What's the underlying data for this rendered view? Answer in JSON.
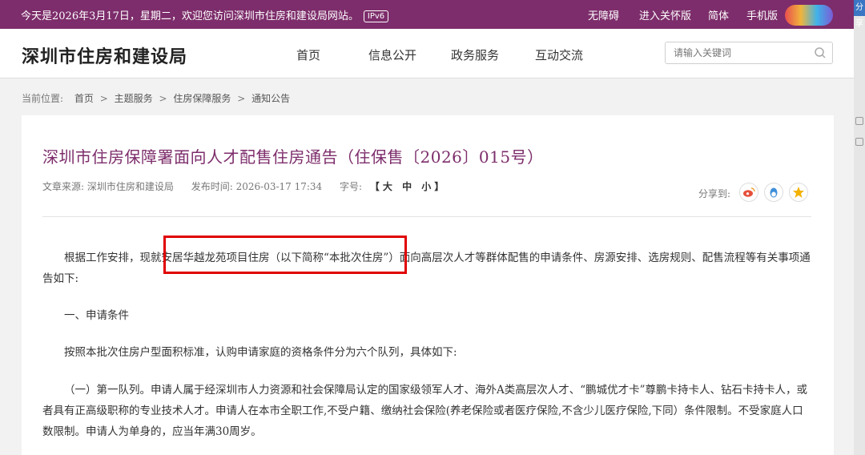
{
  "topbar": {
    "welcome": "今天是2026年3月17日，星期二，欢迎您访问深圳市住房和建设局网站。",
    "ipv6_badge": "IPv6",
    "links": [
      "无障碍",
      "进入关怀版",
      "简体",
      "手机版"
    ],
    "edge_tag": "分享"
  },
  "header": {
    "site_title": "深圳市住房和建设局",
    "nav": [
      "首页",
      "信息公开",
      "政务服务",
      "互动交流"
    ],
    "search_placeholder": "请输入关键词"
  },
  "breadcrumb": {
    "label": "当前位置:",
    "items": [
      "首页",
      "主题服务",
      "住房保障服务",
      "通知公告"
    ]
  },
  "article": {
    "title": "深圳市住房保障署面向人才配售住房通告（住保售〔2026〕015号）",
    "source_label": "文章来源:",
    "source": "深圳市住房和建设局",
    "time_label": "发布时间:",
    "time": "2026-03-17 17:34",
    "font_label": "字号:",
    "font_sizes": "【大 中 小】",
    "share_label": "分享到:",
    "paragraphs": [
      "根据工作安排，现就安居华越龙苑项目住房（以下简称“本批次住房”）面向高层次人才等群体配售的申请条件、房源安排、选房规则、配售流程等有关事项通告如下:",
      "一、申请条件",
      "按照本批次住房户型面积标准，认购申请家庭的资格条件分为六个队列，具体如下:",
      "（一）第一队列。申请人属于经深圳市人力资源和社会保障局认定的国家级领军人才、海外A类高层次人才、“鹏城优才卡”尊鹏卡持卡人、钻石卡持卡人，或者具有正高级职称的专业技术人才。申请人在本市全职工作,不受户籍、缴纳社会保险(养老保险或者医疗保险,不含少儿医疗保险,下同）条件限制。不受家庭人口数限制。申请人为单身的，应当年满30周岁。"
    ]
  },
  "colors": {
    "brand": "#7d2d6b",
    "highlight_box": "#e00000"
  }
}
